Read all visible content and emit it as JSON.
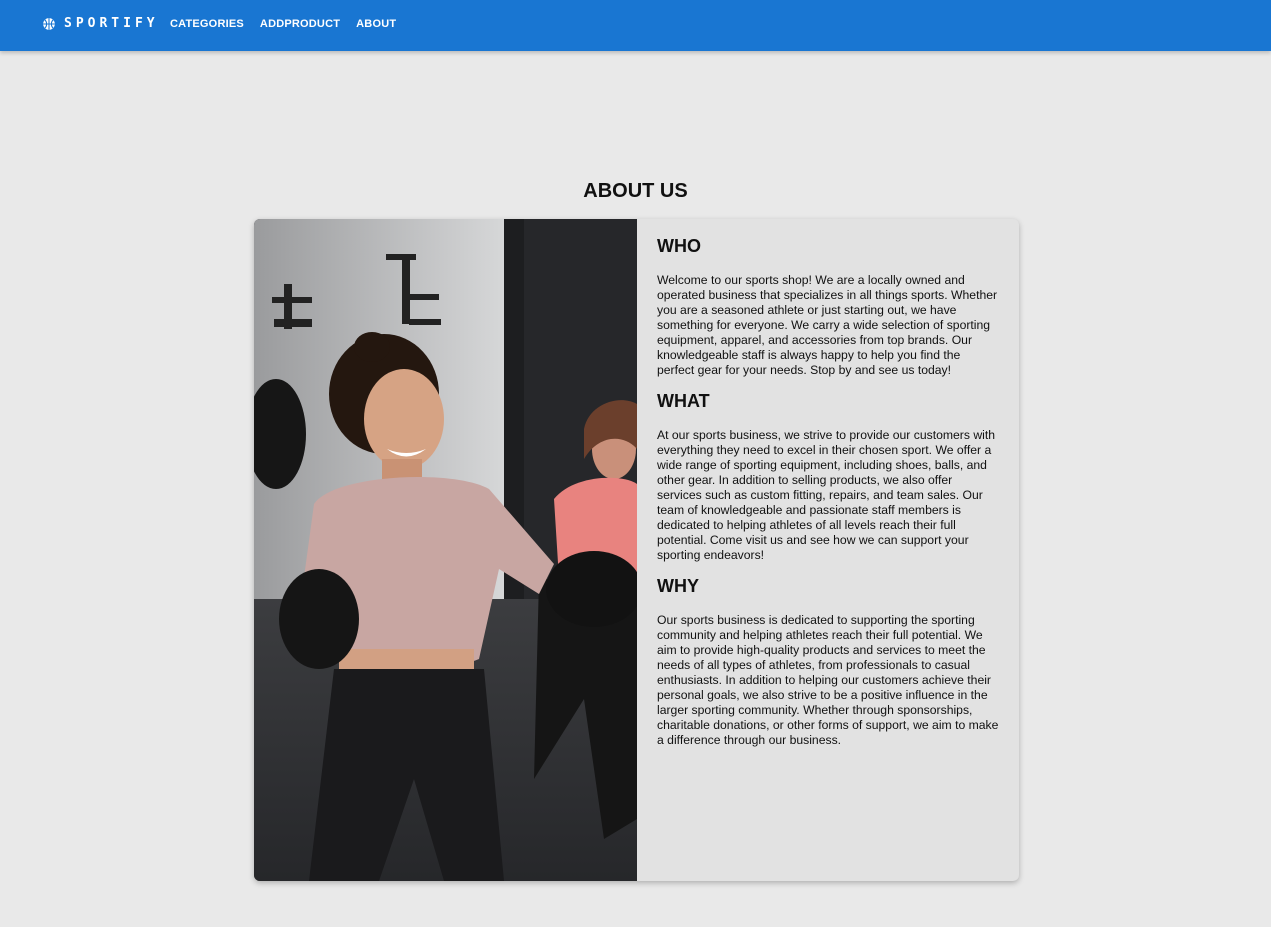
{
  "header": {
    "brand": "SPORTIFY",
    "brand_icon": "basketball-icon",
    "nav": [
      {
        "label": "CATEGORIES"
      },
      {
        "label": "ADDPRODUCT"
      },
      {
        "label": "ABOUT"
      }
    ]
  },
  "page_title": "ABOUT US",
  "photo": {
    "subject": "boxing-photo"
  },
  "sections": [
    {
      "heading": "WHO",
      "text": "Welcome to our sports shop! We are a locally owned and operated business that specializes in all things sports. Whether you are a seasoned athlete or just starting out, we have something for everyone. We carry a wide selection of sporting equipment, apparel, and accessories from top brands. Our knowledgeable staff is always happy to help you find the perfect gear for your needs. Stop by and see us today!"
    },
    {
      "heading": "WHAT",
      "text": "At our sports business, we strive to provide our customers with everything they need to excel in their chosen sport. We offer a wide range of sporting equipment, including shoes, balls, and other gear. In addition to selling products, we also offer services such as custom fitting, repairs, and team sales. Our team of knowledgeable and passionate staff members is dedicated to helping athletes of all levels reach their full potential. Come visit us and see how we can support your sporting endeavors!"
    },
    {
      "heading": "WHY",
      "text": "Our sports business is dedicated to supporting the sporting community and helping athletes reach their full potential. We aim to provide high-quality products and services to meet the needs of all types of athletes, from professionals to casual enthusiasts. In addition to helping our customers achieve their personal goals, we also strive to be a positive influence in the larger sporting community. Whether through sponsorships, charitable donations, or other forms of support, we aim to make a difference through our business."
    }
  ],
  "colors": {
    "appbar": "#1976d2",
    "background": "#e9e9e9",
    "card": "#e2e2e2"
  }
}
